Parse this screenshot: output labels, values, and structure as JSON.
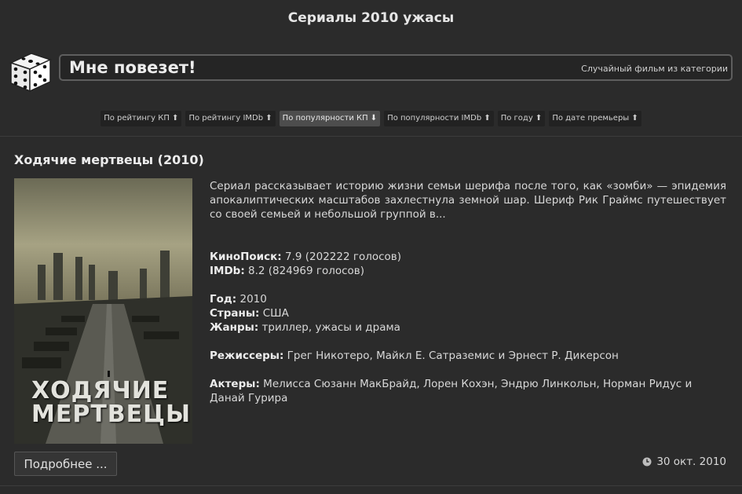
{
  "header": {
    "title": "Сериалы 2010 ужасы"
  },
  "lucky": {
    "label": "Мне повезет!",
    "hint": "Случайный фильм из категории",
    "icon": "dice-icon"
  },
  "sorts": [
    {
      "label": "По рейтингу КП ⬆",
      "active": false
    },
    {
      "label": "По рейтингу IMDb ⬆",
      "active": false
    },
    {
      "label": "По популярности КП ⬇",
      "active": true
    },
    {
      "label": "По популярности IMDb ⬆",
      "active": false
    },
    {
      "label": "По году ⬆",
      "active": false
    },
    {
      "label": "По дате премьеры ⬆",
      "active": false
    }
  ],
  "film": {
    "title": "Ходячие мертвецы (2010)",
    "poster_text": "ХОДЯЧИЕ МЕРТВЕЦЫ",
    "description": "Сериал рассказывает историю жизни семьи шерифа после того, как «зомби» — эпидемия апокалиптических масштабов захлестнула земной шар. Шериф Рик Граймс путешествует со своей семьей и небольшой группой в...",
    "kp_label": "КиноПоиск:",
    "kp_value": " 7.9 (202222 голосов)",
    "imdb_label": "IMDb:",
    "imdb_value": " 8.2 (824969 голосов)",
    "year_label": "Год:",
    "year_value": " 2010",
    "countries_label": "Страны:",
    "countries_value": " США",
    "genres_label": "Жанры:",
    "genres_value": " триллер, ужасы и драма",
    "directors_label": "Режиссеры:",
    "directors_value": " Грег Никотеро, Майкл Е. Сатраземис и Эрнест Р. Дикерсон",
    "actors_label": "Актеры:",
    "actors_value": " Мелисса Сюзанн МакБрайд, Лорен Кохэн, Эндрю Линкольн, Норман Ридус и Данай Гурира",
    "more_label": "Подробнее ...",
    "date": "30 окт. 2010"
  }
}
